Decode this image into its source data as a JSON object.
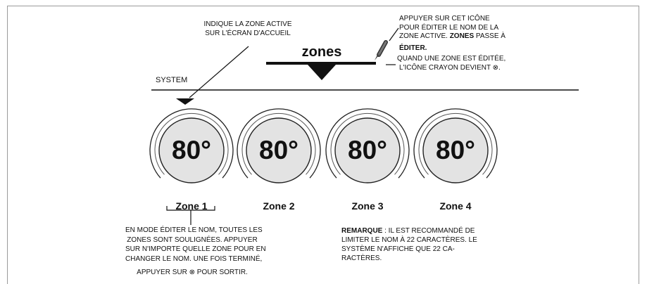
{
  "header": {
    "title": "zones",
    "system_label": "SYSTEM"
  },
  "callouts": {
    "active_zone": [
      "INDIQUE LA ZONE ACTIVE",
      "SUR L'ÉCRAN D'ACCUEIL"
    ],
    "pencil": {
      "line1": "APPUYER SUR CET ICÔNE",
      "line2": "POUR ÉDITER LE NOM DE LA",
      "line3_pre": "ZONE ACTIVE. ",
      "line3_bold": "ZONES",
      "line3_post": " PASSE À",
      "line4_bold": "ÉDITER.",
      "line5": "QUAND UNE ZONE EST ÉDITÉE,",
      "line6": "L'ICÔNE CRAYON DEVIENT  ⊗."
    },
    "edit_mode": [
      "EN MODE ÉDITER LE NOM, TOUTES LES",
      "ZONES SONT SOULIGNÉES. APPUYER",
      "SUR N'IMPORTE QUELLE ZONE POUR EN",
      "CHANGER LE NOM. UNE FOIS TERMINÉ,",
      "APPUYER SUR ⊗ POUR SORTIR."
    ],
    "note": {
      "label": "REMARQUE",
      "line1_post": " : IL EST RECOMMANDÉ DE",
      "line2": "LIMITER LE NOM À 22 CARACTÈRES. LE",
      "line3": "SYSTÈME N'AFFICHE QUE 22 CA-",
      "line4": "RACTÈRES."
    }
  },
  "zones": [
    {
      "label": "Zone 1",
      "temp": "80°"
    },
    {
      "label": "Zone 2",
      "temp": "80°"
    },
    {
      "label": "Zone 3",
      "temp": "80°"
    },
    {
      "label": "Zone 4",
      "temp": "80°"
    }
  ]
}
